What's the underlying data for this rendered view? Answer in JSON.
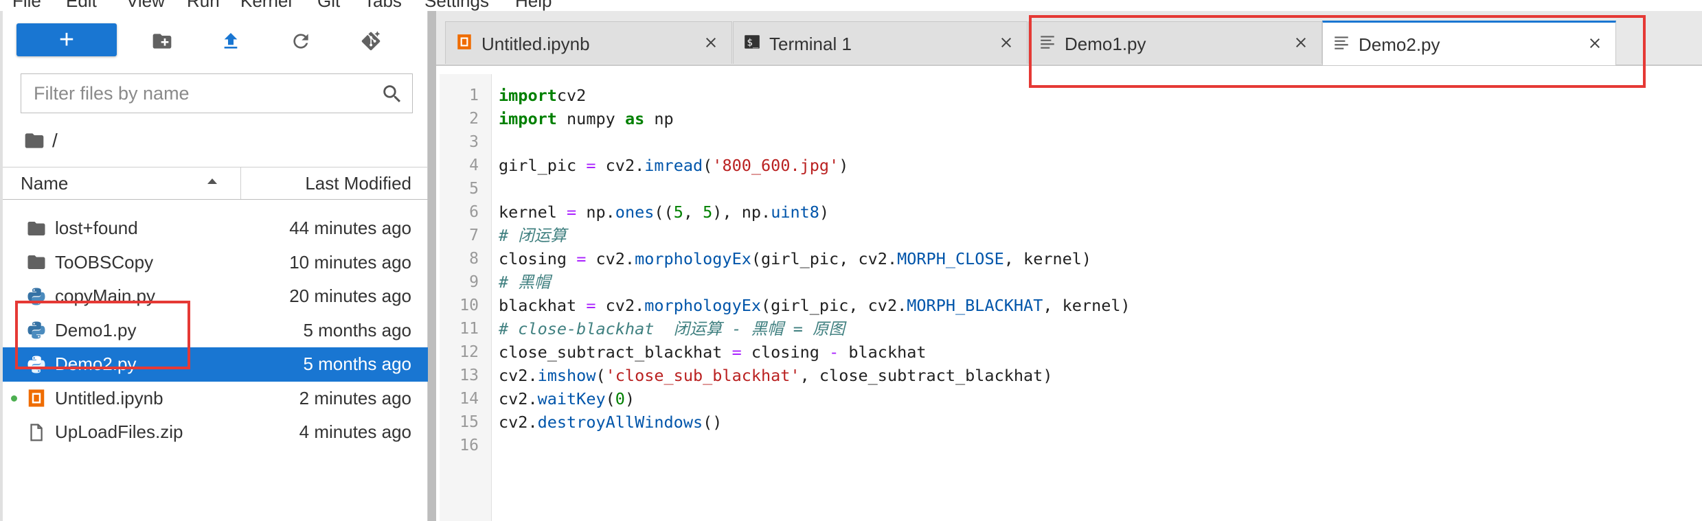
{
  "menubar": {
    "items": [
      "File",
      "Edit",
      "View",
      "Run",
      "Kernel",
      "Git",
      "Tabs",
      "Settings",
      "Help"
    ]
  },
  "toolbar": {
    "new_label": "+",
    "icons": [
      "new-folder-icon",
      "upload-icon",
      "refresh-icon",
      "git-clone-icon"
    ]
  },
  "filter": {
    "placeholder": "Filter files by name"
  },
  "breadcrumb": {
    "path": "/"
  },
  "file_browser": {
    "columns": {
      "name": "Name",
      "modified": "Last Modified"
    },
    "files": [
      {
        "name": "lost+found",
        "modified": "44 minutes ago",
        "type": "folder",
        "selected": false,
        "running": false
      },
      {
        "name": "ToOBSCopy",
        "modified": "10 minutes ago",
        "type": "folder",
        "selected": false,
        "running": false
      },
      {
        "name": "copyMain.py",
        "modified": "20 minutes ago",
        "type": "python",
        "selected": false,
        "running": false
      },
      {
        "name": "Demo1.py",
        "modified": "5 months ago",
        "type": "python",
        "selected": false,
        "running": false
      },
      {
        "name": "Demo2.py",
        "modified": "5 months ago",
        "type": "python",
        "selected": true,
        "running": false
      },
      {
        "name": "Untitled.ipynb",
        "modified": "2 minutes ago",
        "type": "notebook",
        "selected": false,
        "running": true
      },
      {
        "name": "UpLoadFiles.zip",
        "modified": "4 minutes ago",
        "type": "file",
        "selected": false,
        "running": false
      }
    ]
  },
  "tabs": [
    {
      "label": "Untitled.ipynb",
      "icon": "notebook-icon",
      "active": false
    },
    {
      "label": "Terminal 1",
      "icon": "terminal-icon",
      "active": false
    },
    {
      "label": "Demo1.py",
      "icon": "text-file-icon",
      "active": false
    },
    {
      "label": "Demo2.py",
      "icon": "text-file-icon",
      "active": true
    }
  ],
  "editor": {
    "line_numbers": [
      "1",
      "2",
      "3",
      "4",
      "5",
      "6",
      "7",
      "8",
      "9",
      "10",
      "11",
      "12",
      "13",
      "14",
      "15",
      "16"
    ],
    "lines": [
      [
        [
          "kw",
          "import"
        ],
        [
          "",
          "cv2"
        ]
      ],
      [
        [
          "kw",
          "import"
        ],
        [
          "",
          " numpy "
        ],
        [
          "kw",
          "as"
        ],
        [
          "",
          " np"
        ]
      ],
      [],
      [
        [
          "",
          "girl_pic "
        ],
        [
          "op",
          "="
        ],
        [
          "",
          " cv2."
        ],
        [
          "attr",
          "imread"
        ],
        [
          "",
          "("
        ],
        [
          "str",
          "'800_600.jpg'"
        ],
        [
          "",
          ")"
        ]
      ],
      [],
      [
        [
          "",
          "kernel "
        ],
        [
          "op",
          "="
        ],
        [
          "",
          " np."
        ],
        [
          "attr",
          "ones"
        ],
        [
          "",
          "(("
        ],
        [
          "num",
          "5"
        ],
        [
          "",
          ", "
        ],
        [
          "num",
          "5"
        ],
        [
          "",
          "), np."
        ],
        [
          "attr",
          "uint8"
        ],
        [
          "",
          ")"
        ]
      ],
      [
        [
          "cmt",
          "# 闭运算"
        ]
      ],
      [
        [
          "",
          "closing "
        ],
        [
          "op",
          "="
        ],
        [
          "",
          " cv2."
        ],
        [
          "attr",
          "morphologyEx"
        ],
        [
          "",
          "(girl_pic, cv2."
        ],
        [
          "attr",
          "MORPH_CLOSE"
        ],
        [
          "",
          ", kernel)"
        ]
      ],
      [
        [
          "cmt",
          "# 黑帽"
        ]
      ],
      [
        [
          "",
          "blackhat "
        ],
        [
          "op",
          "="
        ],
        [
          "",
          " cv2."
        ],
        [
          "attr",
          "morphologyEx"
        ],
        [
          "",
          "(girl_pic, cv2."
        ],
        [
          "attr",
          "MORPH_BLACKHAT"
        ],
        [
          "",
          ", kernel)"
        ]
      ],
      [
        [
          "cmt",
          "# close-blackhat  闭运算 - 黑帽 = 原图"
        ]
      ],
      [
        [
          "",
          "close_subtract_blackhat "
        ],
        [
          "op",
          "="
        ],
        [
          "",
          " closing "
        ],
        [
          "op",
          "-"
        ],
        [
          "",
          " blackhat"
        ]
      ],
      [
        [
          "",
          "cv2."
        ],
        [
          "attr",
          "imshow"
        ],
        [
          "",
          "("
        ],
        [
          "str",
          "'close_sub_blackhat'"
        ],
        [
          "",
          ", close_subtract_blackhat)"
        ]
      ],
      [
        [
          "",
          "cv2."
        ],
        [
          "attr",
          "waitKey"
        ],
        [
          "",
          "("
        ],
        [
          "num",
          "0"
        ],
        [
          "",
          ")"
        ]
      ],
      [
        [
          "",
          "cv2."
        ],
        [
          "attr",
          "destroyAllWindows"
        ],
        [
          "",
          "()"
        ]
      ],
      []
    ]
  },
  "colors": {
    "accent": "#1976d2",
    "highlight_box": "#e53935",
    "running_dot": "#4caf50"
  }
}
